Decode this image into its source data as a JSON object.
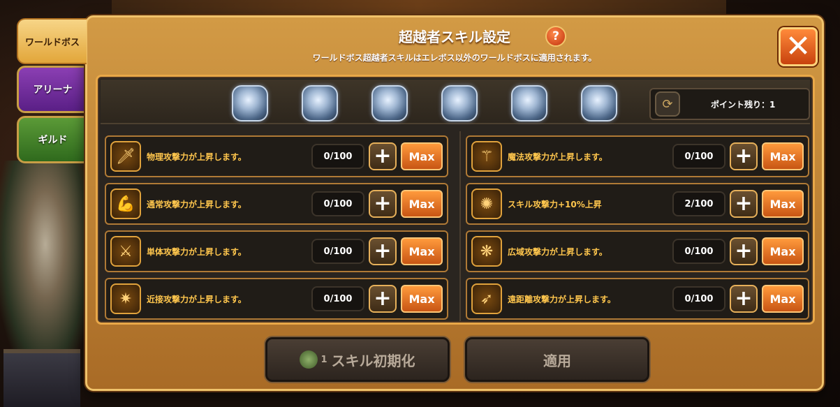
{
  "tabs": [
    {
      "label": "ワールドボス"
    },
    {
      "label": "アリーナ"
    },
    {
      "label": "ギルド"
    }
  ],
  "dialog": {
    "title": "超越者スキル設定",
    "help": "?",
    "subtitle": "ワールドボス超越者スキルはエレボス以外のワールドボスに適用されます。",
    "close": "✕"
  },
  "bosses": [
    {
      "icon": "lion-boss-icon"
    },
    {
      "icon": "helm-boss-icon"
    },
    {
      "icon": "dragon-boss-icon"
    },
    {
      "icon": "golem-boss-icon"
    },
    {
      "icon": "reaper-boss-icon"
    },
    {
      "icon": "horned-boss-icon"
    }
  ],
  "points": {
    "label": "ポイント残り：1",
    "icon": "refresh-icon"
  },
  "skills_left": [
    {
      "name": "物理攻撃力が上昇します。",
      "value": "0/100",
      "icon": "sword-icon"
    },
    {
      "name": "通常攻撃力が上昇します。",
      "value": "0/100",
      "icon": "arm-icon"
    },
    {
      "name": "単体攻撃力が上昇します。",
      "value": "0/100",
      "icon": "single-target-icon"
    },
    {
      "name": "近接攻撃力が上昇します。",
      "value": "0/100",
      "icon": "melee-icon"
    }
  ],
  "skills_right": [
    {
      "name": "魔法攻撃力が上昇します。",
      "value": "0/100",
      "icon": "staff-icon"
    },
    {
      "name": "スキル攻撃力+10%上昇",
      "value": "2/100",
      "icon": "skill-icon"
    },
    {
      "name": "広域攻撃力が上昇します。",
      "value": "0/100",
      "icon": "area-icon"
    },
    {
      "name": "遠距離攻撃力が上昇します。",
      "value": "0/100",
      "icon": "bow-icon"
    }
  ],
  "buttons": {
    "plus": "+",
    "max": "Max",
    "reset": "スキル初期化",
    "reset_cost": "1",
    "apply": "適用"
  }
}
